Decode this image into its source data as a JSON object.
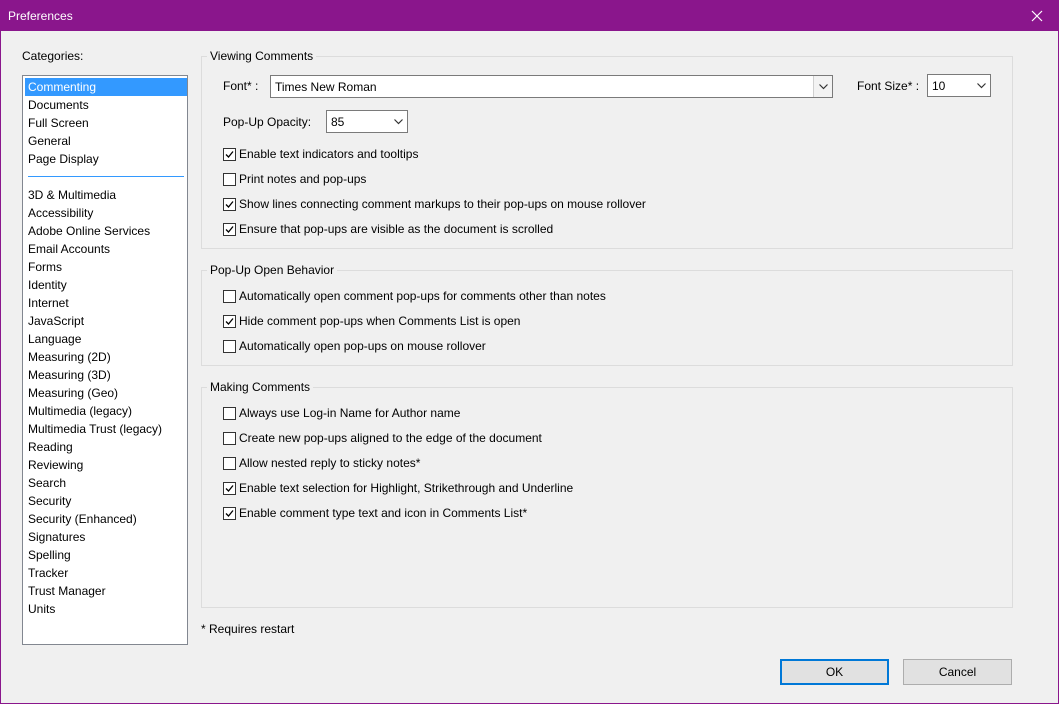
{
  "window": {
    "title": "Preferences"
  },
  "categories": {
    "label": "Categories:",
    "group1": [
      "Commenting",
      "Documents",
      "Full Screen",
      "General",
      "Page Display"
    ],
    "group2": [
      "3D & Multimedia",
      "Accessibility",
      "Adobe Online Services",
      "Email Accounts",
      "Forms",
      "Identity",
      "Internet",
      "JavaScript",
      "Language",
      "Measuring (2D)",
      "Measuring (3D)",
      "Measuring (Geo)",
      "Multimedia (legacy)",
      "Multimedia Trust (legacy)",
      "Reading",
      "Reviewing",
      "Search",
      "Security",
      "Security (Enhanced)",
      "Signatures",
      "Spelling",
      "Tracker",
      "Trust Manager",
      "Units"
    ],
    "selected": "Commenting"
  },
  "viewing": {
    "title": "Viewing Comments",
    "font_label": "Font* :",
    "font_value": "Times New Roman",
    "font_size_label": "Font Size* :",
    "font_size_value": "10",
    "opacity_label": "Pop-Up Opacity:",
    "opacity_value": "85",
    "checkboxes": [
      {
        "label": "Enable text indicators and tooltips",
        "checked": true
      },
      {
        "label": "Print notes and pop-ups",
        "checked": false
      },
      {
        "label": "Show lines connecting comment markups to their pop-ups on mouse rollover",
        "checked": true
      },
      {
        "label": "Ensure that pop-ups are visible as the document is scrolled",
        "checked": true
      }
    ]
  },
  "popup": {
    "title": "Pop-Up Open Behavior",
    "checkboxes": [
      {
        "label": "Automatically open comment pop-ups for comments other than notes",
        "checked": false
      },
      {
        "label": "Hide comment pop-ups when Comments List is open",
        "checked": true
      },
      {
        "label": "Automatically open pop-ups on mouse rollover",
        "checked": false
      }
    ]
  },
  "making": {
    "title": "Making Comments",
    "checkboxes": [
      {
        "label": "Always use Log-in Name for Author name",
        "checked": false
      },
      {
        "label": "Create new pop-ups aligned to the edge of the document",
        "checked": false
      },
      {
        "label": "Allow nested reply to sticky notes*",
        "checked": false
      },
      {
        "label": "Enable text selection for Highlight, Strikethrough and Underline",
        "checked": true
      },
      {
        "label": "Enable comment type text and icon in Comments List*",
        "checked": true
      }
    ]
  },
  "footer": {
    "note": "* Requires restart",
    "ok_label": "OK",
    "cancel_label": "Cancel"
  },
  "colors": {
    "titlebar": "#8a168c",
    "selection": "#3399ff",
    "default_button_border": "#0078d7"
  }
}
